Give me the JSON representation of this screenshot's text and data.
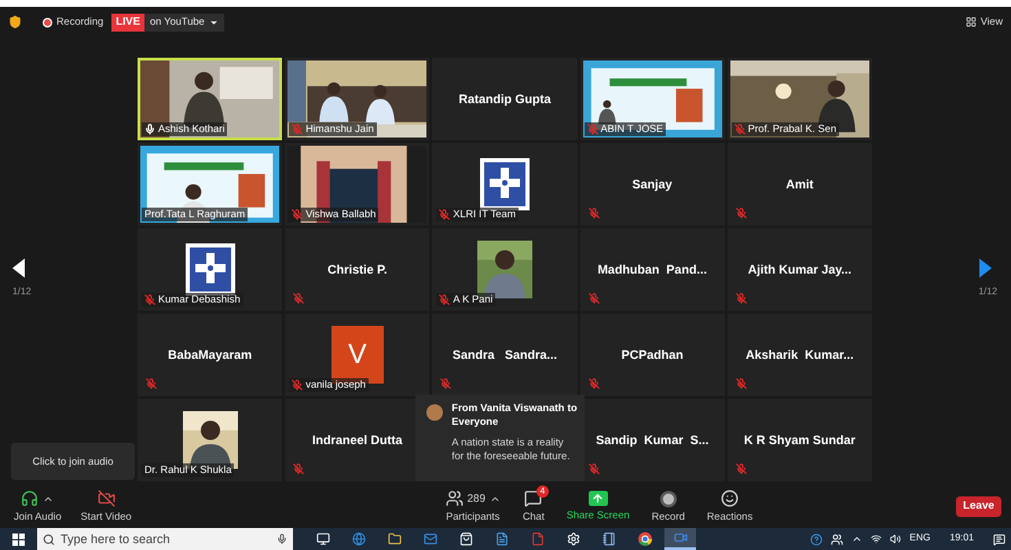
{
  "top_bar": {
    "recording_label": "Recording",
    "live_badge": "LIVE",
    "stream_label": "on YouTube",
    "view_label": "View"
  },
  "pager": {
    "left_page": "1/12",
    "right_page": "1/12"
  },
  "tiles": [
    {
      "kind": "video",
      "name": "Ashish Kothari",
      "mic_muted": false,
      "speaking": true
    },
    {
      "kind": "video",
      "name": "Himanshu Jain",
      "mic_muted": true,
      "speaking": false
    },
    {
      "kind": "name",
      "name": "Ratandip Gupta",
      "speaking": false
    },
    {
      "kind": "video",
      "name": "ABIN T JOSE",
      "mic_muted": true,
      "speaking": false
    },
    {
      "kind": "video",
      "name": "Prof. Prabal K. Sen",
      "mic_muted": true,
      "speaking": false
    },
    {
      "kind": "video",
      "name": "Prof.Tata L Raghuram",
      "speaking": false
    },
    {
      "kind": "video",
      "name": "Vishwa Ballabh",
      "mic_muted": true,
      "speaking": false
    },
    {
      "kind": "logo",
      "name": "XLRI IT Team",
      "mic_muted": true,
      "speaking": false
    },
    {
      "kind": "name",
      "name": "Sanjay",
      "mic_muted": true,
      "speaking": false
    },
    {
      "kind": "name",
      "name": "Amit",
      "mic_muted": true,
      "speaking": false
    },
    {
      "kind": "logo",
      "name": "Kumar Debashish",
      "mic_muted": true,
      "speaking": false
    },
    {
      "kind": "name",
      "name": "Christie P.",
      "mic_muted": true,
      "speaking": false
    },
    {
      "name": "A K Pani",
      "mic_muted": true,
      "speaking": false
    },
    {
      "kind": "name",
      "name": "Madhuban  Pand...",
      "mic_muted": true,
      "speaking": false
    },
    {
      "kind": "name",
      "name": "Ajith Kumar Jay...",
      "mic_muted": true,
      "speaking": false
    },
    {
      "kind": "name",
      "name": "BabaMayaram",
      "mic_muted": true,
      "speaking": false
    },
    {
      "kind": "letter",
      "letter": "V",
      "name": "vanila joseph",
      "mic_muted": true,
      "speaking": false
    },
    {
      "kind": "name",
      "name": "Sandra   Sandra...",
      "mic_muted": true,
      "speaking": false
    },
    {
      "kind": "name",
      "name": "PCPadhan",
      "mic_muted": true,
      "speaking": false
    },
    {
      "kind": "name",
      "name": "Aksharik  Kumar...",
      "mic_muted": true,
      "speaking": false
    },
    {
      "name": "Dr. Rahul K Shukla",
      "speaking": false
    },
    {
      "kind": "name",
      "name": "Indraneel Dutta",
      "mic_muted": true,
      "speaking": false
    },
    {
      "kind": "name",
      "name": "Sandip  Kumar  S...",
      "mic_muted": true,
      "speaking": false
    },
    {
      "kind": "name",
      "name": "K R Shyam Sundar",
      "mic_muted": true,
      "speaking": false
    }
  ],
  "chat_popup": {
    "heading": "From Vanita Viswanath to Everyone",
    "message": "A nation state is a reality for the foreseeable future."
  },
  "audio_tooltip": "Click to join audio",
  "toolbar": [
    {
      "kind": "audio",
      "label": "Join Audio"
    },
    {
      "kind": "video",
      "label": "Start Video"
    },
    {
      "kind": "participants",
      "label": "Participants",
      "count": "289"
    },
    {
      "kind": "chat",
      "label": "Chat",
      "badge": "4"
    },
    {
      "kind": "share",
      "label": "Share Screen"
    },
    {
      "kind": "record",
      "label": "Record"
    },
    {
      "kind": "reactions",
      "label": "Reactions"
    }
  ],
  "leave_button": "Leave",
  "taskbar": {
    "search_placeholder": "Type here to search",
    "apps": [
      {
        "selected": false
      },
      {
        "selected": false
      },
      {
        "selected": false
      },
      {
        "selected": false
      },
      {
        "selected": false
      },
      {
        "selected": false
      },
      {
        "selected": false
      },
      {
        "selected": false
      },
      {
        "selected": false
      },
      {
        "selected": false
      },
      {
        "selected": true
      }
    ],
    "language": "ENG",
    "time": "19:01"
  }
}
